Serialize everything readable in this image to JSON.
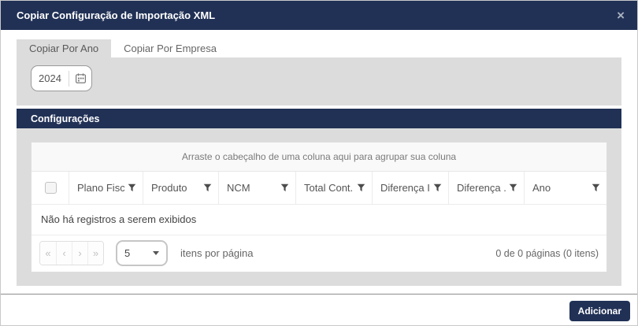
{
  "modal": {
    "title": "Copiar Configuração de Importação XML",
    "close_label": "×"
  },
  "tabs": [
    {
      "label": "Copiar Por Ano",
      "active": true
    },
    {
      "label": "Copiar Por Empresa",
      "active": false
    }
  ],
  "year_picker": {
    "value": "2024"
  },
  "section": {
    "title": "Configurações"
  },
  "grid": {
    "group_hint": "Arraste o cabeçalho de uma coluna aqui para agrupar sua coluna",
    "columns": [
      "Plano Fiscal",
      "Produto",
      "NCM",
      "Total Cont...",
      "Diferença I...",
      "Diferença ...",
      "Ano"
    ],
    "empty_message": "Não há registros a serem exibidos",
    "pager": {
      "first": "«",
      "prev": "‹",
      "next": "›",
      "last": "»",
      "page_size": "5",
      "page_size_label": "itens por página",
      "info": "0 de 0 páginas (0 itens)"
    }
  },
  "footer": {
    "add_label": "Adicionar"
  },
  "colors": {
    "navy": "#213156",
    "panel_gray": "#dcdcdc"
  }
}
